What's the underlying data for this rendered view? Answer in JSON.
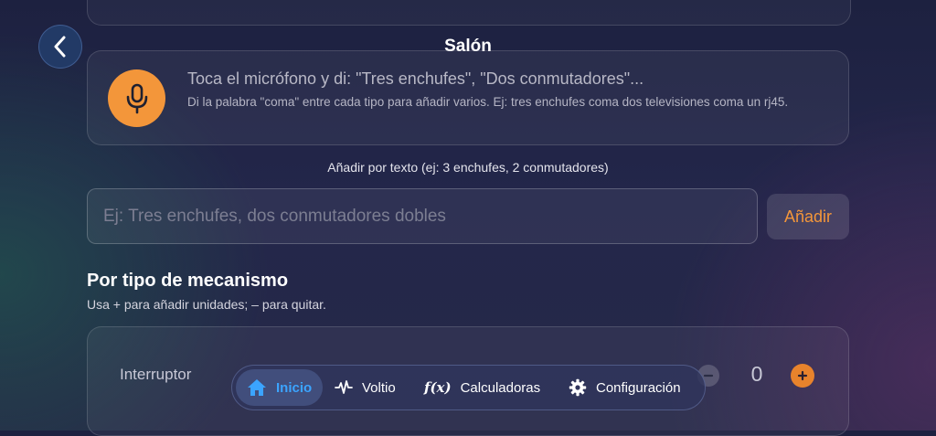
{
  "header": {
    "title": "Salón",
    "back_icon": "chevron-left-icon"
  },
  "voice": {
    "mic_icon": "microphone-icon",
    "headline": "Toca el micrófono y di: \"Tres enchufes\", \"Dos conmutadores\"...",
    "help": "Di la palabra \"coma\" entre cada tipo para añadir varios. Ej: tres enchufes coma dos televisiones coma un rj45."
  },
  "text_entry": {
    "hint": "Añadir por texto (ej: 3 enchufes, 2 conmutadores)",
    "placeholder": "Ej: Tres enchufes, dos conmutadores dobles",
    "value": "",
    "add_label": "Añadir"
  },
  "mechanisms": {
    "title": "Por tipo de mecanismo",
    "subtitle": "Usa + para añadir unidades; – para quitar.",
    "items": [
      {
        "label": "Interruptor",
        "count": "0"
      }
    ]
  },
  "tabbar": {
    "tabs": [
      {
        "label": "Inicio",
        "icon": "home-icon",
        "active": true
      },
      {
        "label": "Voltio",
        "icon": "waveform-icon",
        "active": false
      },
      {
        "label": "Calculadoras",
        "icon": "function-icon",
        "glyph": "f(x)",
        "active": false
      },
      {
        "label": "Configuración",
        "icon": "gear-icon",
        "active": false
      }
    ]
  },
  "colors": {
    "accent_orange": "#F3963A",
    "active_tab_blue": "#3BA4FF",
    "back_button": "#223A66"
  }
}
